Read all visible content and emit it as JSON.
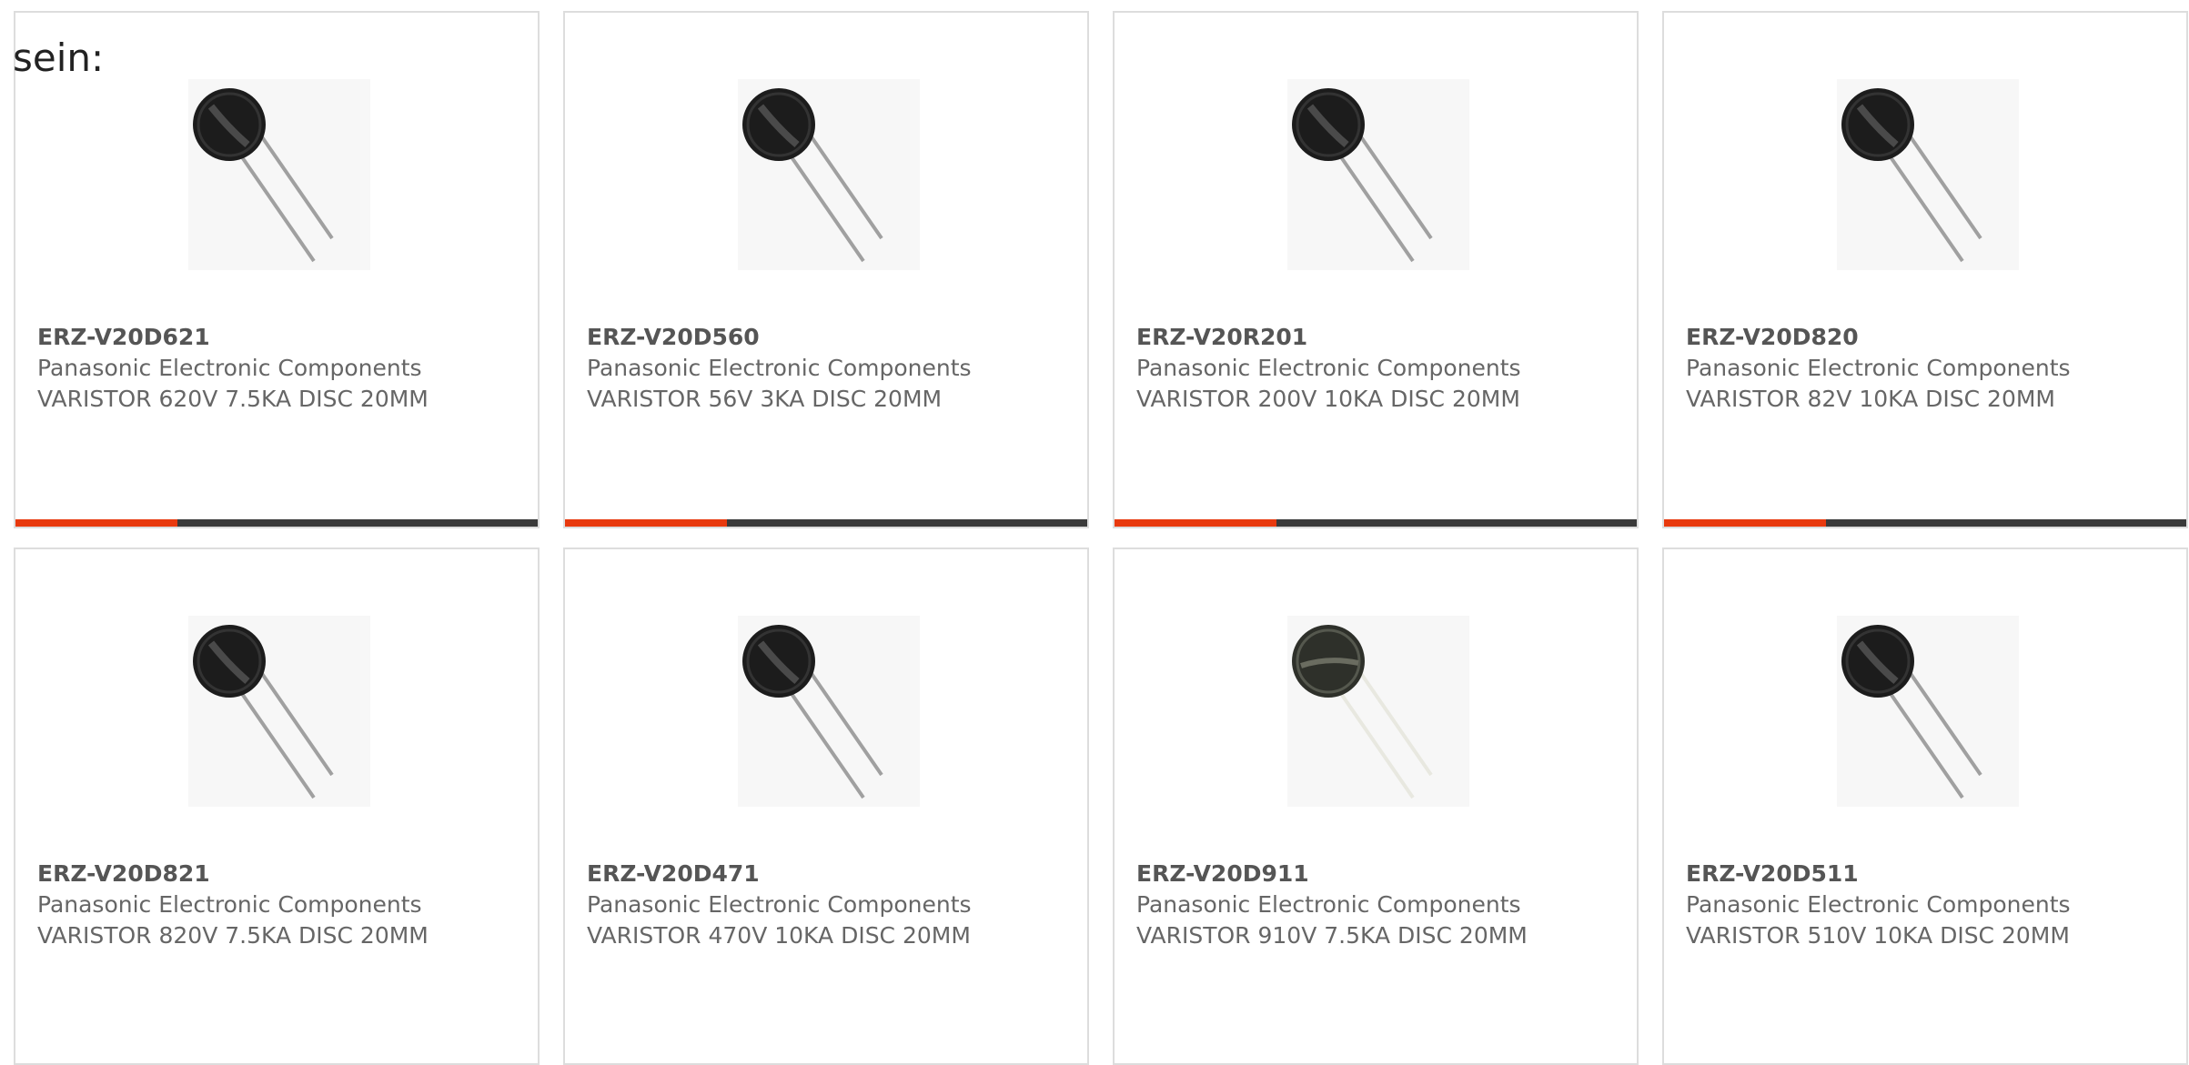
{
  "intro_text": "sein:",
  "colors": {
    "accent": "#e8390e",
    "bar": "#3a3a3a",
    "border": "#dddddd",
    "text": "#666666"
  },
  "products": [
    {
      "part_number": "ERZ-V20D621",
      "manufacturer": "Panasonic Electronic Components",
      "description": "VARISTOR 620V 7.5KA DISC 20MM",
      "image_icon": "varistor-disc-icon",
      "accent_fraction": 0.31
    },
    {
      "part_number": "ERZ-V20D560",
      "manufacturer": "Panasonic Electronic Components",
      "description": "VARISTOR 56V 3KA DISC 20MM",
      "image_icon": "varistor-disc-icon",
      "accent_fraction": 0.31
    },
    {
      "part_number": "ERZ-V20R201",
      "manufacturer": "Panasonic Electronic Components",
      "description": "VARISTOR 200V 10KA DISC 20MM",
      "image_icon": "varistor-disc-icon",
      "accent_fraction": 0.31
    },
    {
      "part_number": "ERZ-V20D820",
      "manufacturer": "Panasonic Electronic Components",
      "description": "VARISTOR 82V 10KA DISC 20MM",
      "image_icon": "varistor-disc-icon",
      "accent_fraction": 0.31
    },
    {
      "part_number": "ERZ-V20D821",
      "manufacturer": "Panasonic Electronic Components",
      "description": "VARISTOR 820V 7.5KA DISC 20MM",
      "image_icon": "varistor-disc-icon",
      "accent_fraction": 0
    },
    {
      "part_number": "ERZ-V20D471",
      "manufacturer": "Panasonic Electronic Components",
      "description": "VARISTOR 470V 10KA DISC 20MM",
      "image_icon": "varistor-disc-icon",
      "accent_fraction": 0
    },
    {
      "part_number": "ERZ-V20D911",
      "manufacturer": "Panasonic Electronic Components",
      "description": "VARISTOR 910V 7.5KA DISC 20MM",
      "image_icon": "varistor-disc-icon",
      "accent_fraction": 0
    },
    {
      "part_number": "ERZ-V20D511",
      "manufacturer": "Panasonic Electronic Components",
      "description": "VARISTOR 510V 10KA DISC 20MM",
      "image_icon": "varistor-disc-icon",
      "accent_fraction": 0
    }
  ]
}
